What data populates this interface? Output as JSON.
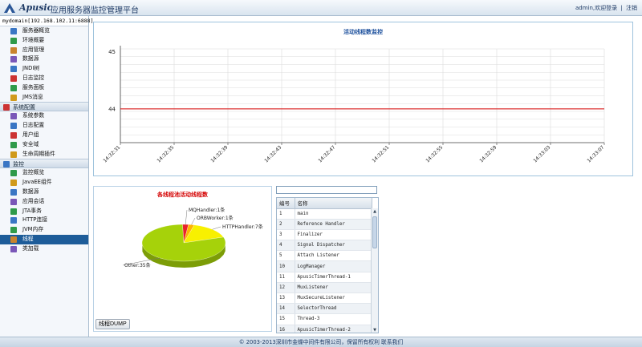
{
  "header": {
    "brand": "Apusic",
    "title": "应用服务器监控管理平台",
    "user_text": "admin,欢迎登录",
    "separator": "|",
    "logout": "注销"
  },
  "sidebar": {
    "domain": "mydomain[192.168.102.11:6888]",
    "groups": [
      {
        "label": "",
        "items": [
          "服务器概览",
          "环境概要",
          "应用管理",
          "数据源",
          "JNDI树",
          "日志监控",
          "服务面板",
          "JMS消息"
        ]
      },
      {
        "label": "系统配置",
        "items": [
          "系统参数",
          "日志配置",
          "用户组",
          "安全域",
          "生命周期插件"
        ]
      },
      {
        "label": "监控",
        "items": [
          "监控概览",
          "JavaEE组件",
          "数据源",
          "应用会话",
          "JTA事务",
          "HTTP连接",
          "JVM内存",
          "线程",
          "类加载"
        ]
      }
    ],
    "active_item": "线程"
  },
  "thread_chart": {
    "title": "活动线程数监控",
    "colors": {
      "line": "#d40000",
      "grid": "#dcdcdc"
    }
  },
  "chart_data": [
    {
      "type": "line",
      "title": "活动线程数监控",
      "x": [
        "14:32:31",
        "14:32:35",
        "14:32:39",
        "14:32:43",
        "14:32:47",
        "14:32:51",
        "14:32:55",
        "14:32:59",
        "14:33:03",
        "14:33:07"
      ],
      "y_ticks": [
        44,
        45
      ],
      "ylim": [
        43.41,
        45.05
      ],
      "series": [
        {
          "values": [
            44,
            44,
            44,
            44,
            44,
            44,
            44,
            44,
            44,
            44
          ],
          "color": "#d40000"
        }
      ],
      "grid": true
    },
    {
      "type": "pie",
      "title": "各线程池活动线程数",
      "slices": [
        {
          "label": "MQHandler:1条",
          "value": 1,
          "color": "#e8222a"
        },
        {
          "label": "ORBWorker:1条",
          "value": 1,
          "color": "#ffb400"
        },
        {
          "label": "HTTPHandler:7条",
          "value": 7,
          "color": "#f8f000"
        },
        {
          "label": "Other:35条",
          "value": 35,
          "color": "#a6d20a"
        }
      ]
    }
  ],
  "dump_button": "线程DUMP",
  "thread_table": {
    "search_value": "",
    "headers": [
      "编号",
      "名称"
    ],
    "rows": [
      [
        "1",
        "main"
      ],
      [
        "2",
        "Reference Handler"
      ],
      [
        "3",
        "Finalizer"
      ],
      [
        "4",
        "Signal Dispatcher"
      ],
      [
        "5",
        "Attach Listener"
      ],
      [
        "10",
        "LogManager"
      ],
      [
        "11",
        "ApusicTimerThread-1"
      ],
      [
        "12",
        "MuxListener"
      ],
      [
        "13",
        "MuxSecureListener"
      ],
      [
        "14",
        "SelectorThread"
      ],
      [
        "15",
        "Thread-3"
      ],
      [
        "16",
        "ApusicTimerThread-2"
      ]
    ]
  },
  "footer": "© 2003-2013深圳市金蝶中间件有限公司，保留所有权利  联系我们"
}
